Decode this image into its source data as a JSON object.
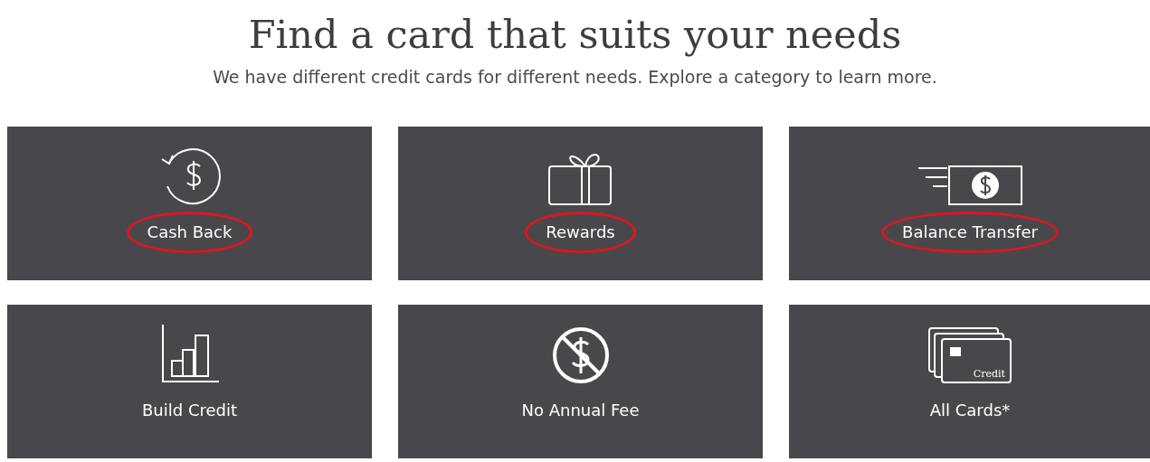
{
  "heading": "Find a card that suits your needs",
  "subheading": "We have different credit cards for different needs. Explore a category to learn more.",
  "categories": [
    {
      "kind": "cash-back",
      "label": "Cash Back",
      "circled": true
    },
    {
      "kind": "rewards",
      "label": "Rewards",
      "circled": true
    },
    {
      "kind": "balance-transfer",
      "label": "Balance Transfer",
      "circled": true
    },
    {
      "kind": "build-credit",
      "label": "Build Credit",
      "circled": false
    },
    {
      "kind": "no-annual-fee",
      "label": "No Annual Fee",
      "circled": false
    },
    {
      "kind": "all-cards",
      "label": "All Cards*",
      "circled": false,
      "card_text": "Credit"
    }
  ]
}
